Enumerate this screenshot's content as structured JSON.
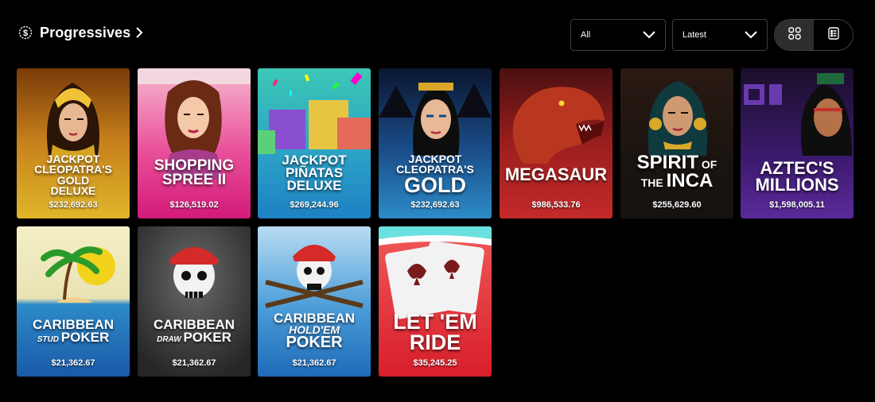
{
  "header": {
    "title": "Progressives",
    "title_icon": "coin-dollar-icon",
    "filter_select": {
      "value": "All"
    },
    "sort_select": {
      "value": "Latest"
    },
    "view_modes": [
      "grid-view-icon",
      "list-view-icon"
    ],
    "active_view": "grid"
  },
  "games": [
    {
      "name": "JACKPOT CLEOPATRA'S GOLD DELUXE",
      "amount": "$232,692.63"
    },
    {
      "name": "SHOPPING SPREE II",
      "amount": "$126,519.02"
    },
    {
      "name": "JACKPOT PIÑATAS DELUXE",
      "amount": "$269,244.96"
    },
    {
      "name": "JACKPOT CLEOPATRA'S GOLD",
      "amount": "$232,692.63"
    },
    {
      "name": "MEGASAUR",
      "amount": "$986,533.76"
    },
    {
      "name": "SPIRIT OF THE INCA",
      "amount": "$255,629.60"
    },
    {
      "name": "AZTEC'S MILLIONS",
      "amount": "$1,598,005.11"
    },
    {
      "name": "CARIBBEAN STUD POKER",
      "amount": "$21,362.67"
    },
    {
      "name": "CARIBBEAN DRAW POKER",
      "amount": "$21,362.67"
    },
    {
      "name": "CARIBBEAN HOLD'EM POKER",
      "amount": "$21,362.67"
    },
    {
      "name": "LET 'EM RIDE",
      "amount": "$35,245.25"
    }
  ]
}
